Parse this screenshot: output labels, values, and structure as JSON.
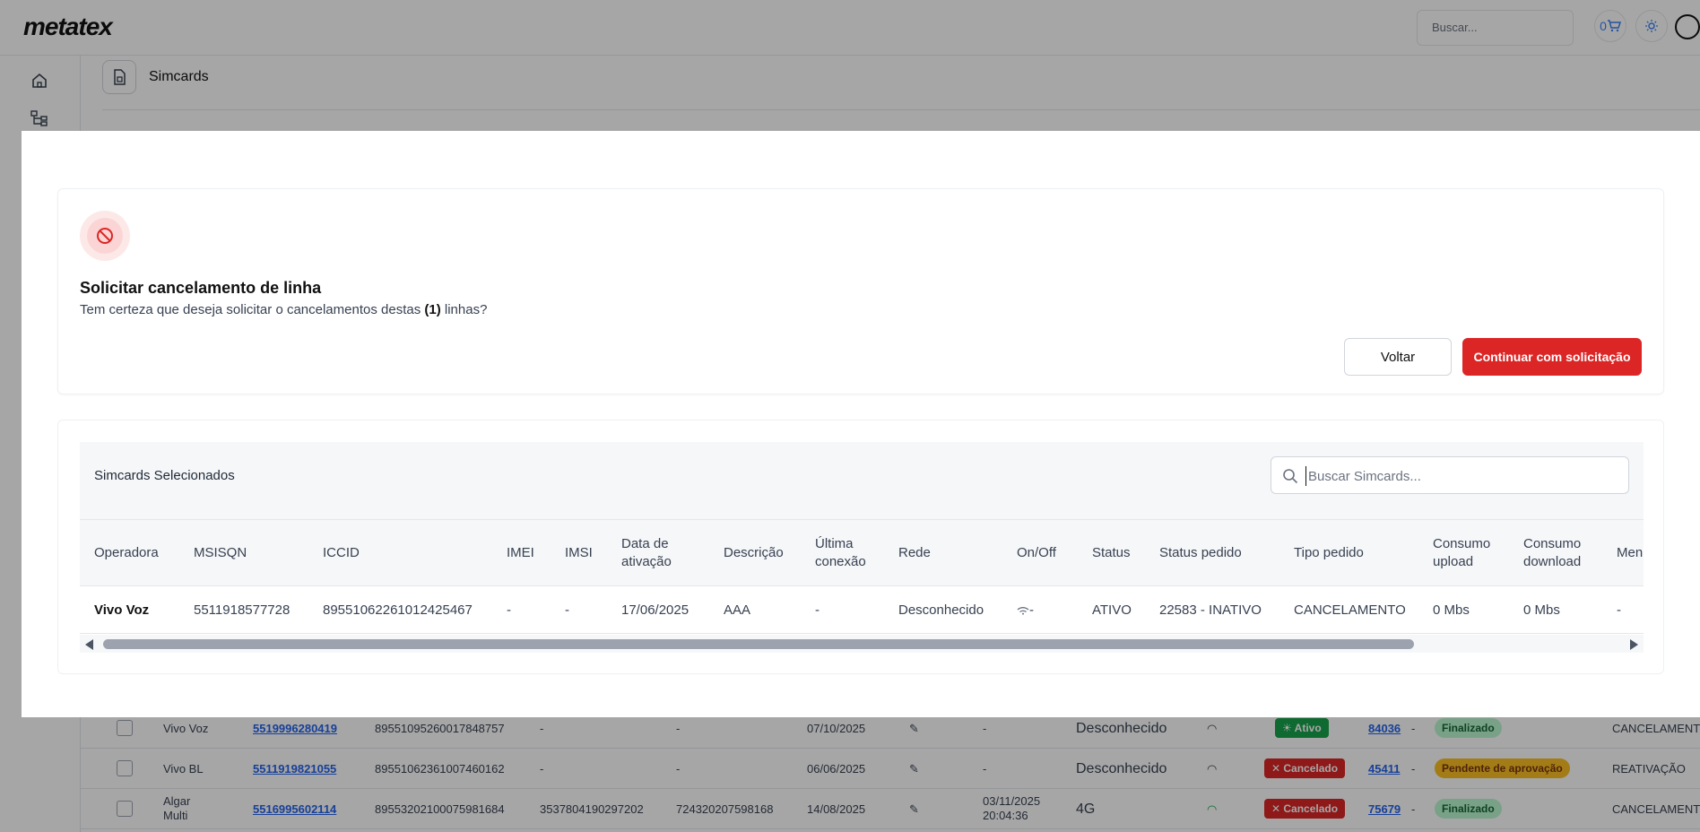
{
  "app": {
    "logo": "metatex",
    "search_placeholder": "Buscar...",
    "cart_count": "0",
    "page_title": "Simcards"
  },
  "background_rows": [
    {
      "operadora": "Vivo Voz",
      "msisdn": "5519996280419",
      "iccid": "89551095260017848757",
      "imei": "-",
      "imsi": "-",
      "data": "07/10/2025",
      "ultima": "-",
      "rede": "Desconhecido",
      "status": "Ativo",
      "pedido": "84036",
      "sep": "-",
      "status_pedido": "Finalizado",
      "tipo": "CANCELAMENTO"
    },
    {
      "operadora": "Vivo BL",
      "msisdn": "5511919821055",
      "iccid": "89551062361007460162",
      "imei": "-",
      "imsi": "-",
      "data": "06/06/2025",
      "ultima": "-",
      "rede": "Desconhecido",
      "status": "Cancelado",
      "pedido": "45411",
      "sep": "-",
      "status_pedido": "Pendente de aprovação",
      "tipo": "REATIVAÇÃO"
    },
    {
      "operadora": "Algar Multi",
      "operadora_l1": "Algar",
      "operadora_l2": "Multi",
      "msisdn": "5516995602114",
      "iccid": "89553202100075981684",
      "imei": "3537804190297202",
      "imsi": "724320207598168",
      "data": "14/08/2025",
      "ultima_l1": "03/11/2025",
      "ultima_l2": "20:04:36",
      "rede": "4G",
      "status": "Cancelado",
      "pedido": "75679",
      "sep": "-",
      "status_pedido": "Finalizado",
      "tipo": "CANCELAMENT"
    }
  ],
  "dialog": {
    "title": "Solicitar cancelamento de linha",
    "message_prefix": "Tem certeza que deseja solicitar o cancelamentos destas ",
    "message_count": "(1)",
    "message_suffix": " linhas?",
    "back_label": "Voltar",
    "continue_label": "Continuar com solicitação",
    "icon": "ban-icon",
    "accent_color": "#dc2626"
  },
  "selected_table": {
    "title": "Simcards Selecionados",
    "search_placeholder": "Buscar Simcards...",
    "columns": [
      {
        "l1": "Operadora",
        "l2": ""
      },
      {
        "l1": "MSISQN",
        "l2": ""
      },
      {
        "l1": "ICCID",
        "l2": ""
      },
      {
        "l1": "IMEI",
        "l2": ""
      },
      {
        "l1": "IMSI",
        "l2": ""
      },
      {
        "l1": "Data de",
        "l2": "ativação"
      },
      {
        "l1": "Descrição",
        "l2": ""
      },
      {
        "l1": "Última",
        "l2": "conexão"
      },
      {
        "l1": "Rede",
        "l2": ""
      },
      {
        "l1": "On/Off",
        "l2": ""
      },
      {
        "l1": "Status",
        "l2": ""
      },
      {
        "l1": "Status pedido",
        "l2": ""
      },
      {
        "l1": "Tipo pedido",
        "l2": ""
      },
      {
        "l1": "Consumo",
        "l2": "upload"
      },
      {
        "l1": "Consumo",
        "l2": "download"
      },
      {
        "l1": "Men",
        "l2": ""
      }
    ],
    "row": {
      "operadora": "Vivo Voz",
      "msisdn": "5511918577728",
      "iccid": "89551062261012425467",
      "imei": "-",
      "imsi": "-",
      "data_ativacao": "17/06/2025",
      "descricao": "AAA",
      "ultima_conexao": "-",
      "rede": "Desconhecido",
      "on_off": "-",
      "status": "ATIVO",
      "status_pedido": "22583 - INATIVO",
      "tipo_pedido": "CANCELAMENTO",
      "consumo_upload": "0 Mbs",
      "consumo_download": "0 Mbs",
      "men": "-"
    }
  }
}
